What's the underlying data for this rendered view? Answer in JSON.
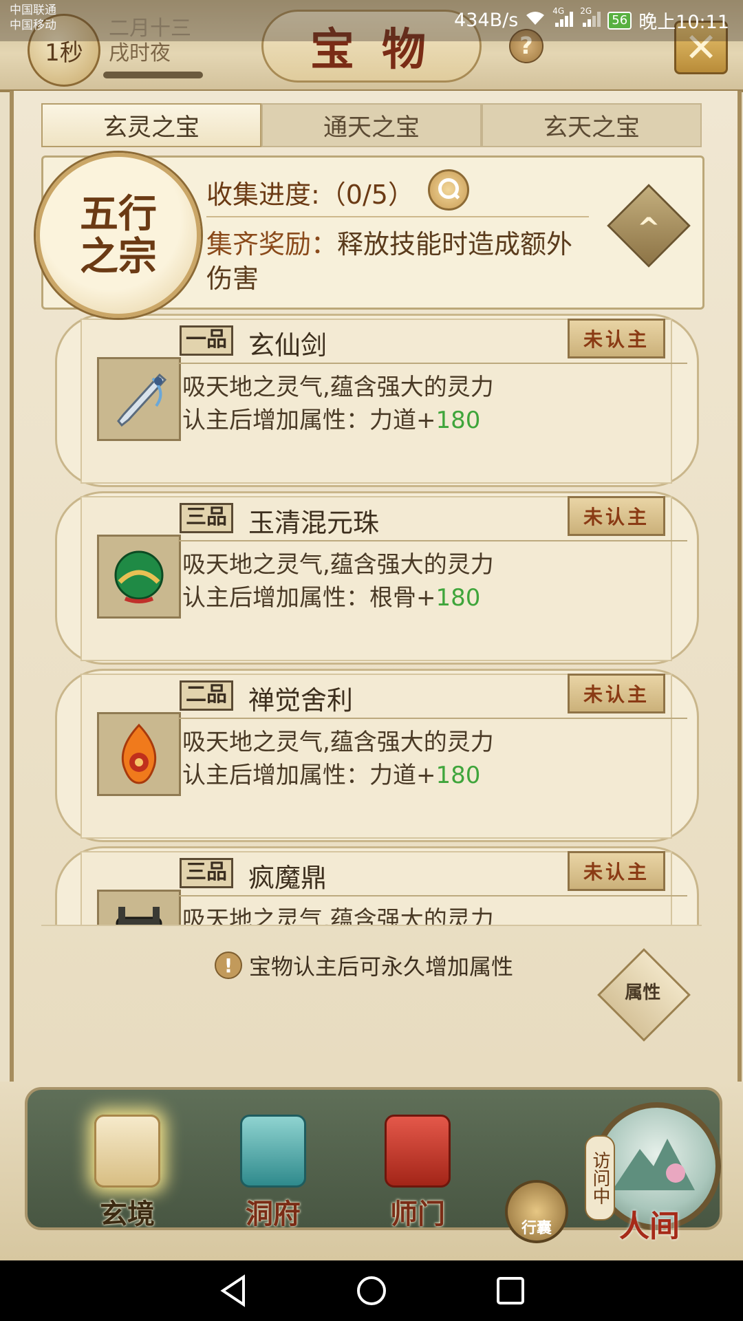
{
  "status_bar": {
    "carrier_1": "中国联通",
    "carrier_2": "中国移动",
    "speed": "434B/s",
    "net_1": "4G",
    "net_2": "2G",
    "battery": "56",
    "time": "晚上10:11"
  },
  "header": {
    "moon_badge": "1秒",
    "lunar_date": "二月十三",
    "time_of_night": "戌时夜",
    "title": "宝物",
    "help_glyph": "?",
    "close_glyph": "✕"
  },
  "tabs": [
    {
      "label": "玄灵之宝",
      "active": true
    },
    {
      "label": "通天之宝",
      "active": false
    },
    {
      "label": "玄天之宝",
      "active": false
    }
  ],
  "set": {
    "emblem_text": "五行之宗",
    "progress_label": "收集进度:（0/5）",
    "reward_key": "集齐奖励：",
    "reward_value": "释放技能时造成额外伤害"
  },
  "treasures": [
    {
      "grade": "一品",
      "name": "玄仙剑",
      "status": "未认主",
      "desc": "吸天地之灵气,蕴含强大的灵力",
      "attr_prefix": "认主后增加属性：力道+",
      "attr_value": "180",
      "icon": "sword-icon"
    },
    {
      "grade": "三品",
      "name": "玉清混元珠",
      "status": "未认主",
      "desc": "吸天地之灵气,蕴含强大的灵力",
      "attr_prefix": "认主后增加属性：根骨+",
      "attr_value": "180",
      "icon": "jade-orb-icon"
    },
    {
      "grade": "二品",
      "name": "禅觉舍利",
      "status": "未认主",
      "desc": "吸天地之灵气,蕴含强大的灵力",
      "attr_prefix": "认主后增加属性：力道+",
      "attr_value": "180",
      "icon": "flame-relic-icon"
    },
    {
      "grade": "三品",
      "name": "疯魔鼎",
      "status": "未认主",
      "desc": "吸天地之灵气,蕴含强大的灵力",
      "attr_prefix": "",
      "attr_value": "",
      "icon": "cauldron-icon"
    }
  ],
  "hint": "宝物认主后可永久增加属性",
  "attributes_button": "属性",
  "bottom_nav": {
    "items": [
      {
        "label": "玄境",
        "icon": "scroll-icon",
        "active": true
      },
      {
        "label": "洞府",
        "icon": "pavilion-icon",
        "active": false
      },
      {
        "label": "师门",
        "icon": "banner-icon",
        "active": false
      }
    ],
    "bag_label": "行囊",
    "visiting": "访问中",
    "world_label": "人间"
  },
  "colors": {
    "accent_red": "#7a2c16",
    "green_value": "#3fa53b",
    "parchment": "#f5edd8"
  }
}
